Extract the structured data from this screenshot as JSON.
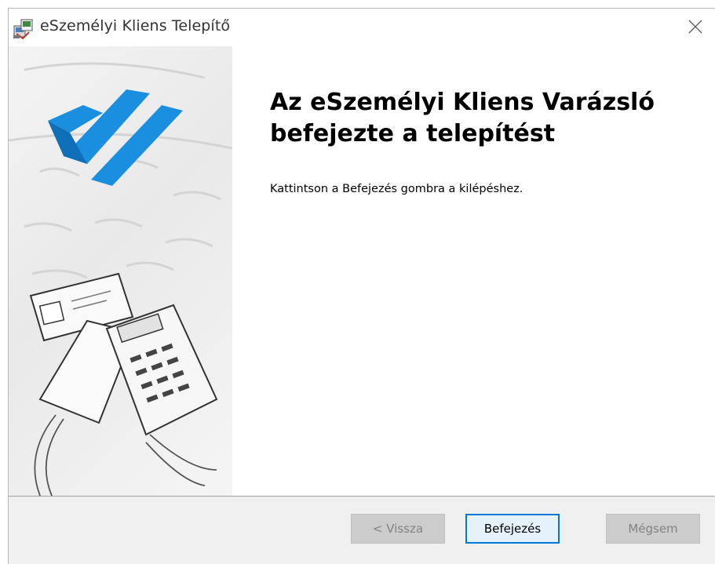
{
  "window": {
    "title": "eSzemélyi Kliens Telepítő",
    "icons": {
      "app": "installer-icon",
      "close": "close-icon"
    }
  },
  "content": {
    "heading_line1": "Az eSzemélyi Kliens Varázsló",
    "heading_line2": "befejezte a telepítést",
    "message": "Kattintson a Befejezés gombra a kilépéshez."
  },
  "buttons": {
    "back": "< Vissza",
    "finish": "Befejezés",
    "cancel": "Mégsem"
  },
  "colors": {
    "accent": "#0078d7",
    "logo_blue": "#1a8fe0",
    "footer_bg": "#f0f0f0"
  }
}
